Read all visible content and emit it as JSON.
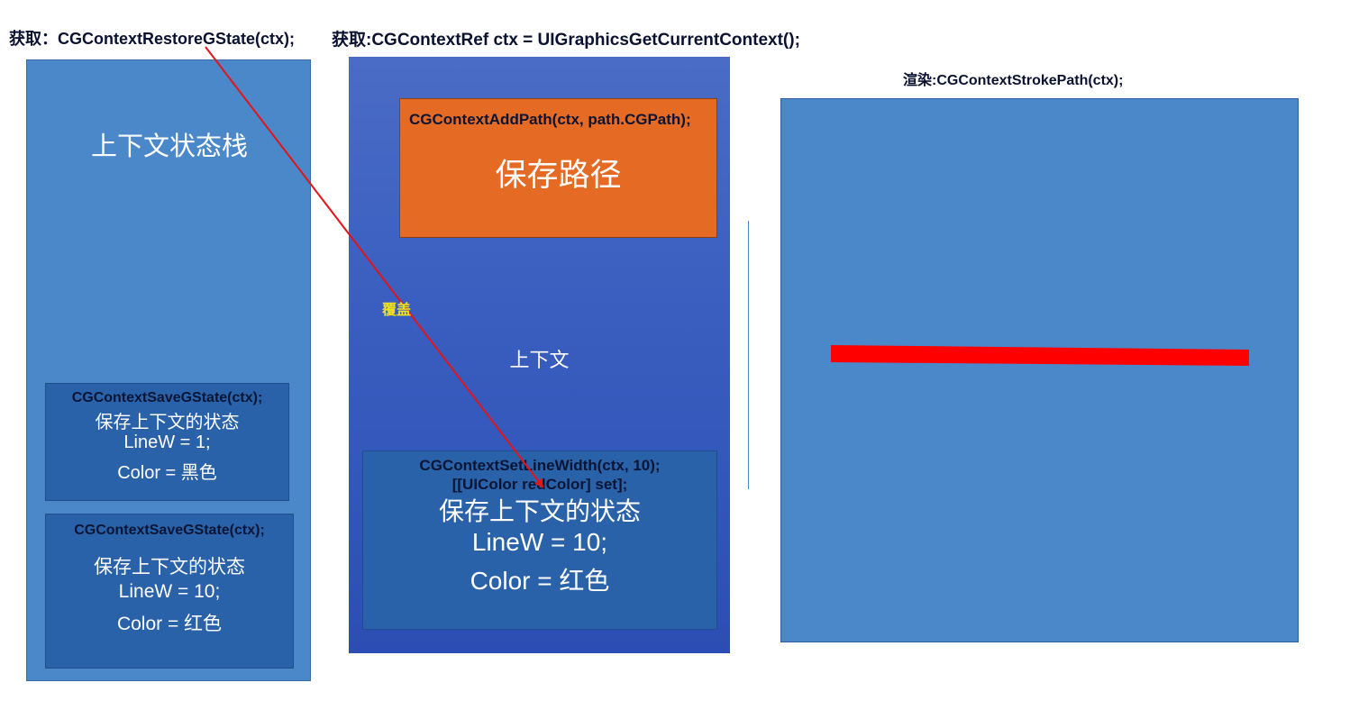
{
  "headers": {
    "restore": "获取：CGContextRestoreGState(ctx);",
    "get_context": "获取:CGContextRef ctx = UIGraphicsGetCurrentContext();",
    "render": "渲染:CGContextStrokePath(ctx);"
  },
  "stack": {
    "title": "上下文状态栈",
    "states": [
      {
        "code": "CGContextSaveGState(ctx);",
        "desc": "保存上下文的状态",
        "line_width": "LineW = 1;",
        "color": "Color = 黑色"
      },
      {
        "code": "CGContextSaveGState(ctx);",
        "desc": "保存上下文的状态",
        "line_width": "LineW = 10;",
        "color": "Color = 红色"
      }
    ]
  },
  "context": {
    "label": "上下文",
    "path_box": {
      "code": "CGContextAddPath(ctx, path.CGPath);",
      "label": "保存路径"
    },
    "state_box": {
      "code_line1": "CGContextSetLineWidth(ctx, 10);",
      "code_line2": "[[UIColor redColor] set];",
      "desc": "保存上下文的状态",
      "line_width": "LineW = 10;",
      "color": "Color = 红色"
    }
  },
  "arrow": {
    "label": "覆盖",
    "color": "#e3141a",
    "label_color": "#f2e21b"
  },
  "render_panel": {
    "stroke_color": "#ff0000"
  },
  "colors": {
    "stack_bg": "#4a88c9",
    "state_bg": "#2962a8",
    "path_bg": "#e56a24",
    "context_bg": "#3a5fc0"
  }
}
